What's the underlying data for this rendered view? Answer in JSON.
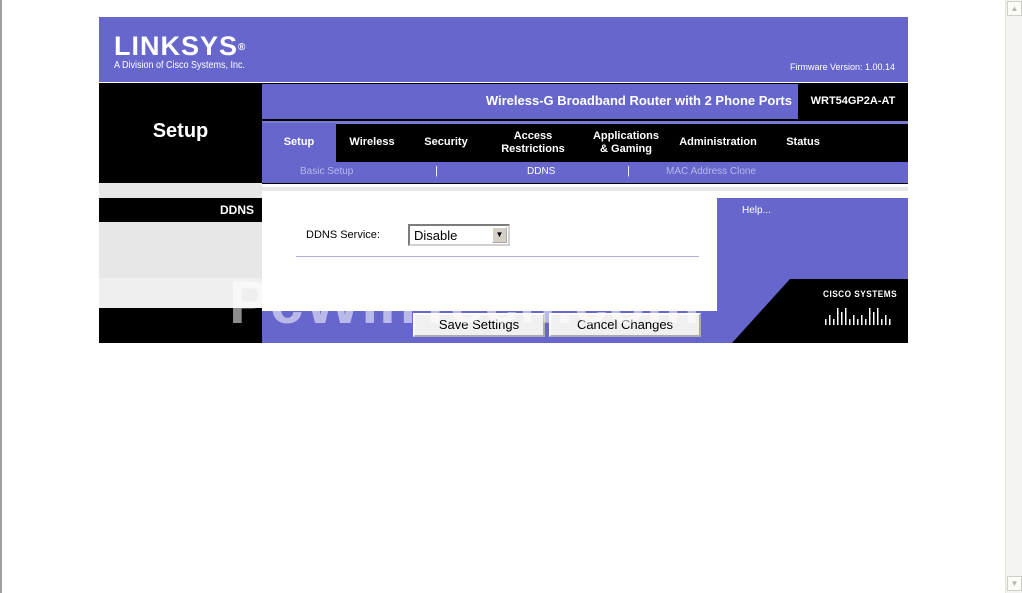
{
  "brand": {
    "logo_text": "LINKSYS",
    "trademark": "®",
    "tagline": "A Division of Cisco Systems, Inc.",
    "firmware": "Firmware Version: 1.00.14"
  },
  "product": {
    "name": "Wireless-G Broadband Router with 2 Phone Ports",
    "model": "WRT54GP2A-AT"
  },
  "page_title": "Setup",
  "tabs": [
    {
      "label": "Setup",
      "active": true
    },
    {
      "label": "Wireless"
    },
    {
      "label": "Security"
    },
    {
      "label": "Access\nRestrictions"
    },
    {
      "label": "Applications\n& Gaming"
    },
    {
      "label": "Administration"
    },
    {
      "label": "Status"
    }
  ],
  "subnav": {
    "items": [
      "Basic Setup",
      "DDNS",
      "MAC Address Clone"
    ],
    "separator": "|",
    "active": "DDNS"
  },
  "section_label": "DDNS",
  "form": {
    "ddns_label": "DDNS Service:",
    "ddns_value": "Disable"
  },
  "help": {
    "label": "Help..."
  },
  "buttons": {
    "save": "Save Settings",
    "cancel": "Cancel Changes"
  },
  "cisco": {
    "text": "CISCO SYSTEMS"
  },
  "watermark": "PcWinTech.com",
  "colors": {
    "brand_purple": "#6666cc",
    "black": "#000000"
  }
}
